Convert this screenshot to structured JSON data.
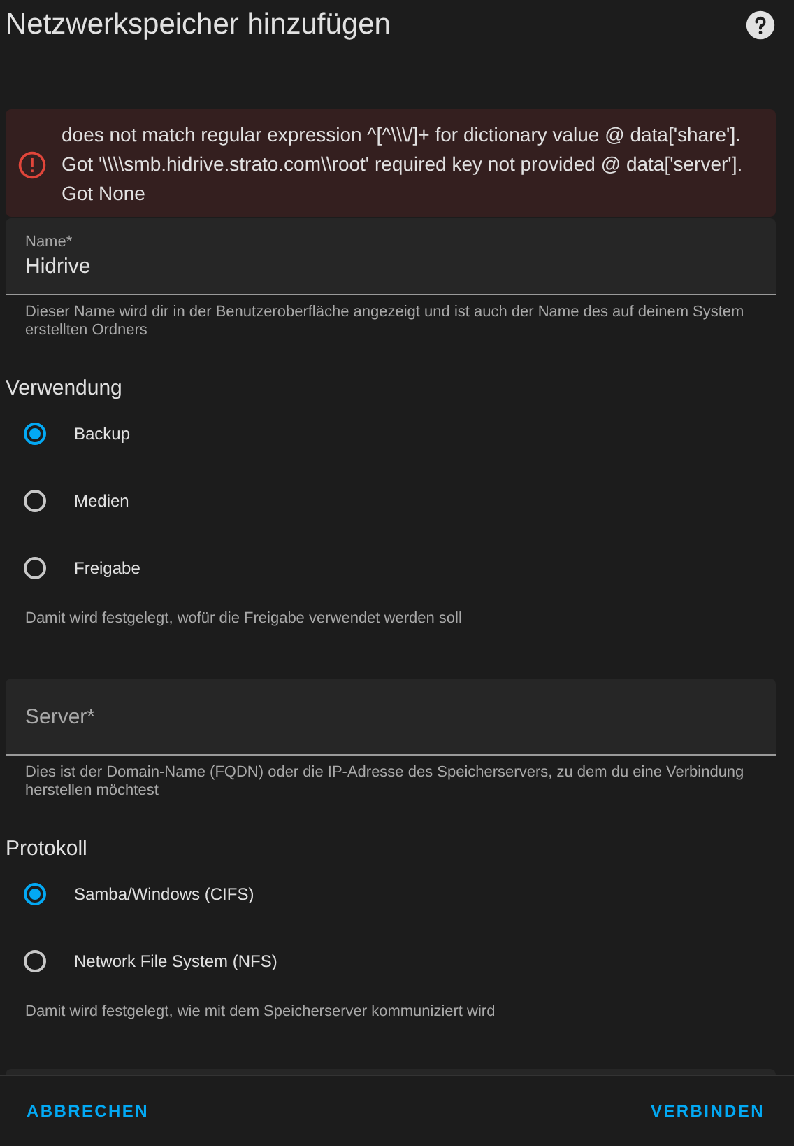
{
  "dialog": {
    "title": "Netzwerkspeicher hinzufügen"
  },
  "error": {
    "message": "does not match regular expression ^[^\\\\\\/]+ for dictionary value @ data['share']. Got '\\\\\\\\smb.hidrive.strato.com\\\\root' required key not provided @ data['server']. Got None"
  },
  "name_field": {
    "label": "Name*",
    "value": "Hidrive",
    "helper": "Dieser Name wird dir in der Benutzeroberfläche angezeigt und ist auch der Name des auf deinem System erstellten Ordners"
  },
  "usage": {
    "heading": "Verwendung",
    "options": [
      {
        "label": "Backup",
        "selected": true
      },
      {
        "label": "Medien",
        "selected": false
      },
      {
        "label": "Freigabe",
        "selected": false
      }
    ],
    "helper": "Damit wird festgelegt, wofür die Freigabe verwendet werden soll"
  },
  "server_field": {
    "placeholder": "Server*",
    "helper": "Dies ist der Domain-Name (FQDN) oder die IP-Adresse des Speicherservers, zu dem du eine Verbindung herstellen möchtest"
  },
  "protocol": {
    "heading": "Protokoll",
    "options": [
      {
        "label": "Samba/Windows (CIFS)",
        "selected": true
      },
      {
        "label": "Network File System (NFS)",
        "selected": false
      }
    ],
    "helper": "Damit wird festgelegt, wie mit dem Speicherserver kommuniziert wird"
  },
  "buttons": {
    "cancel": "ABBRECHEN",
    "confirm": "VERBINDEN"
  }
}
